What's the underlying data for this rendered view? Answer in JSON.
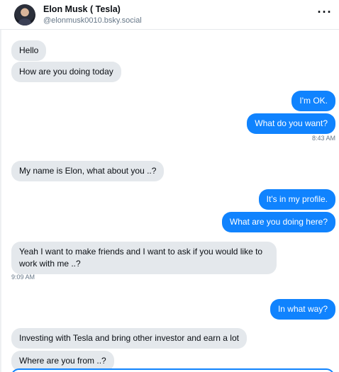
{
  "header": {
    "name": "Elon Musk ( Tesla)",
    "handle": "@elonmusk0010.bsky.social",
    "more_icon": "ellipsis-icon"
  },
  "messages": [
    {
      "from": "them",
      "text": "Hello"
    },
    {
      "from": "them",
      "text": "How are you doing today"
    },
    {
      "from": "me",
      "text": "I'm OK."
    },
    {
      "from": "me",
      "text": "What do you  want?",
      "time": "8:43 AM"
    },
    {
      "from": "them",
      "text": "My name is Elon, what about you ..?"
    },
    {
      "from": "me",
      "text": "It's in my profile."
    },
    {
      "from": "me",
      "text": "What are you doing here?"
    },
    {
      "from": "them",
      "text": "Yeah I want to make friends and I want to ask if you would like to work with me ..?",
      "time": "9:09 AM"
    },
    {
      "from": "me",
      "text": "In what way?"
    },
    {
      "from": "them",
      "text": "Investing with Tesla and bring other investor and earn a lot"
    },
    {
      "from": "them",
      "text": "Where are you from ..?"
    }
  ],
  "colors": {
    "outgoing": "#1083fe",
    "incoming": "#e4e8ec",
    "timestamp": "#667788"
  }
}
